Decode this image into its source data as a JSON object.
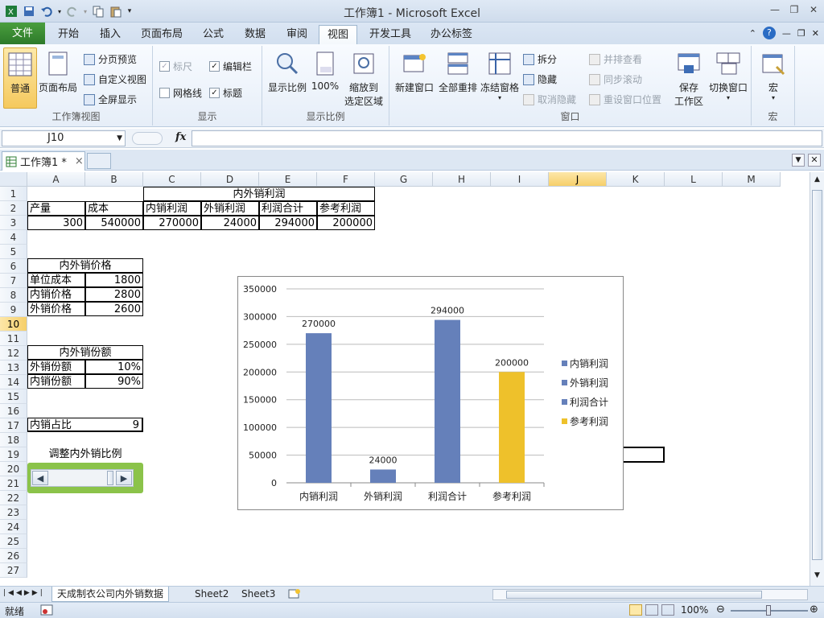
{
  "window": {
    "title": "工作簿1 - Microsoft Excel"
  },
  "tabs": [
    "文件",
    "开始",
    "插入",
    "页面布局",
    "公式",
    "数据",
    "审阅",
    "视图",
    "开发工具",
    "办公标签"
  ],
  "ribbon": {
    "workbook_views": {
      "label": "工作簿视图",
      "normal": "普通",
      "page_layout": "页面布局",
      "page_break": "分页预览",
      "custom_views": "自定义视图",
      "full_screen": "全屏显示"
    },
    "show": {
      "label": "显示",
      "ruler": "标尺",
      "formula_bar": "编辑栏",
      "gridlines": "网格线",
      "headings": "标题"
    },
    "zoom": {
      "label": "显示比例",
      "zoom": "显示比例",
      "hundred": "100%",
      "zoom_selection": "缩放到",
      "zoom_selection2": "选定区域"
    },
    "window": {
      "label": "窗口",
      "new_window": "新建窗口",
      "arrange_all": "全部重排",
      "freeze_panes": "冻结窗格",
      "split": "拆分",
      "hide": "隐藏",
      "unhide": "取消隐藏",
      "side_by_side": "并排查看",
      "sync_scroll": "同步滚动",
      "reset_position": "重设窗口位置",
      "save_workspace": "保存",
      "save_workspace2": "工作区",
      "switch_windows": "切换窗口"
    },
    "macros": {
      "label": "宏",
      "macros": "宏"
    }
  },
  "formula_bar": {
    "name_box": "J10",
    "fx": "fx",
    "value": ""
  },
  "doc_tab": {
    "name": "工作簿1 *",
    "close": "×"
  },
  "columns": [
    "A",
    "B",
    "C",
    "D",
    "E",
    "F",
    "G",
    "H",
    "I",
    "J",
    "K",
    "L",
    "M"
  ],
  "rows": [
    "1",
    "2",
    "3",
    "4",
    "5",
    "6",
    "7",
    "8",
    "9",
    "10",
    "11",
    "12",
    "13",
    "14",
    "15",
    "16",
    "17",
    "18",
    "19",
    "20",
    "21",
    "22",
    "23",
    "24",
    "25",
    "26",
    "27"
  ],
  "cells": {
    "c1": "内外销利润",
    "a2": "产量",
    "b2": "成本",
    "c2": "内销利润",
    "d2": "外销利润",
    "e2": "利润合计",
    "f2": "参考利润",
    "a3": "300",
    "b3": "540000",
    "c3": "270000",
    "d3": "24000",
    "e3": "294000",
    "f3": "200000",
    "a6": "内外销价格",
    "a7": "单位成本",
    "b7": "1800",
    "a8": "内销价格",
    "b8": "2800",
    "a9": "外销价格",
    "b9": "2600",
    "a12": "内外销份额",
    "a13": "外销份额",
    "b13": "10%",
    "a14": "内销份额",
    "b14": "90%",
    "a17": "内销占比",
    "b17": "9",
    "a19": "调整内外销比例"
  },
  "chart_data": {
    "type": "bar",
    "categories": [
      "内销利润",
      "外销利润",
      "利润合计",
      "参考利润"
    ],
    "values": [
      270000,
      24000,
      294000,
      200000
    ],
    "data_labels": [
      "270000",
      "24000",
      "294000",
      "200000"
    ],
    "yticks": [
      "350000",
      "300000",
      "250000",
      "200000",
      "150000",
      "100000",
      "50000",
      "0"
    ],
    "ylim": [
      0,
      350000
    ],
    "colors": [
      "#6580ba",
      "#6580ba",
      "#6580ba",
      "#eec12b"
    ],
    "legend": [
      "内销利润",
      "外销利润",
      "利润合计",
      "参考利润"
    ],
    "legend_position": "right",
    "grid": true
  },
  "sheets": [
    "天成制衣公司内外销数据",
    "Sheet2",
    "Sheet3"
  ],
  "status": {
    "ready": "就绪",
    "zoom": "100%"
  }
}
